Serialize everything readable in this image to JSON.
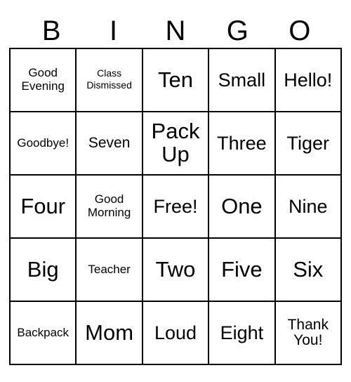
{
  "card": {
    "header": [
      "B",
      "I",
      "N",
      "G",
      "O"
    ],
    "rows": [
      [
        {
          "text": "Good Evening",
          "size": "sz-sm"
        },
        {
          "text": "Class Dismissed",
          "size": "sz-xs"
        },
        {
          "text": "Ten",
          "size": "sz-xl"
        },
        {
          "text": "Small",
          "size": "sz-lg"
        },
        {
          "text": "Hello!",
          "size": "sz-lg"
        }
      ],
      [
        {
          "text": "Goodbye!",
          "size": "sz-sm"
        },
        {
          "text": "Seven",
          "size": "sz-md"
        },
        {
          "text": "Pack Up",
          "size": "sz-xl"
        },
        {
          "text": "Three",
          "size": "sz-lg"
        },
        {
          "text": "Tiger",
          "size": "sz-lg"
        }
      ],
      [
        {
          "text": "Four",
          "size": "sz-xl"
        },
        {
          "text": "Good Morning",
          "size": "sz-sm"
        },
        {
          "text": "Free!",
          "size": "sz-lg"
        },
        {
          "text": "One",
          "size": "sz-xl"
        },
        {
          "text": "Nine",
          "size": "sz-lg"
        }
      ],
      [
        {
          "text": "Big",
          "size": "sz-xl"
        },
        {
          "text": "Teacher",
          "size": "sz-sm"
        },
        {
          "text": "Two",
          "size": "sz-xl"
        },
        {
          "text": "Five",
          "size": "sz-xl"
        },
        {
          "text": "Six",
          "size": "sz-xl"
        }
      ],
      [
        {
          "text": "Backpack",
          "size": "sz-sm"
        },
        {
          "text": "Mom",
          "size": "sz-xl"
        },
        {
          "text": "Loud",
          "size": "sz-lg"
        },
        {
          "text": "Eight",
          "size": "sz-lg"
        },
        {
          "text": "Thank You!",
          "size": "sz-md"
        }
      ]
    ]
  }
}
